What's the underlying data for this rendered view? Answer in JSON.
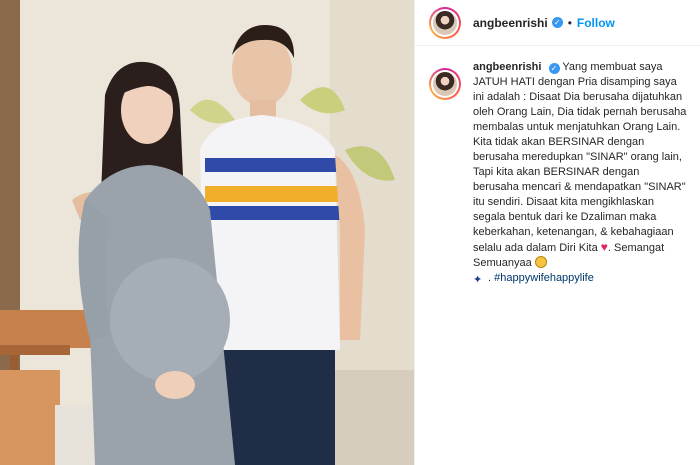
{
  "header": {
    "username": "angbeenrishi",
    "separator": "•",
    "follow_label": "Follow"
  },
  "post": {
    "username": "angbeenrishi",
    "caption": "Yang membuat saya JATUH HATI dengan Pria disamping saya ini adalah : Disaat Dia berusaha dijatuhkan oleh Orang Lain, Dia tidak pernah berusaha membalas untuk menjatuhkan Orang Lain. Kita tidak akan BERSINAR dengan berusaha meredupkan \"SINAR\" orang lain, Tapi kita akan BERSINAR dengan berusaha mencari & mendapatkan \"SINAR\" itu sendiri. Disaat kita mengikhlaskan segala bentuk dari ke Dzaliman maka keberkahan, ketenangan, & kebahagiaan selalu ada dalam Diri Kita",
    "caption_tail": "Semangat Semuanyaa",
    "hashtag": "#happywifehappylife"
  },
  "icons": {
    "verified": "verified-badge-icon",
    "heart": "red-heart-icon",
    "emoji": "smiling-face-icon",
    "sparkles": "sparkles-icon"
  },
  "colors": {
    "follow": "#0095f6",
    "verified": "#3897f0",
    "hashtag": "#00376b",
    "heart": "#e0245e"
  }
}
